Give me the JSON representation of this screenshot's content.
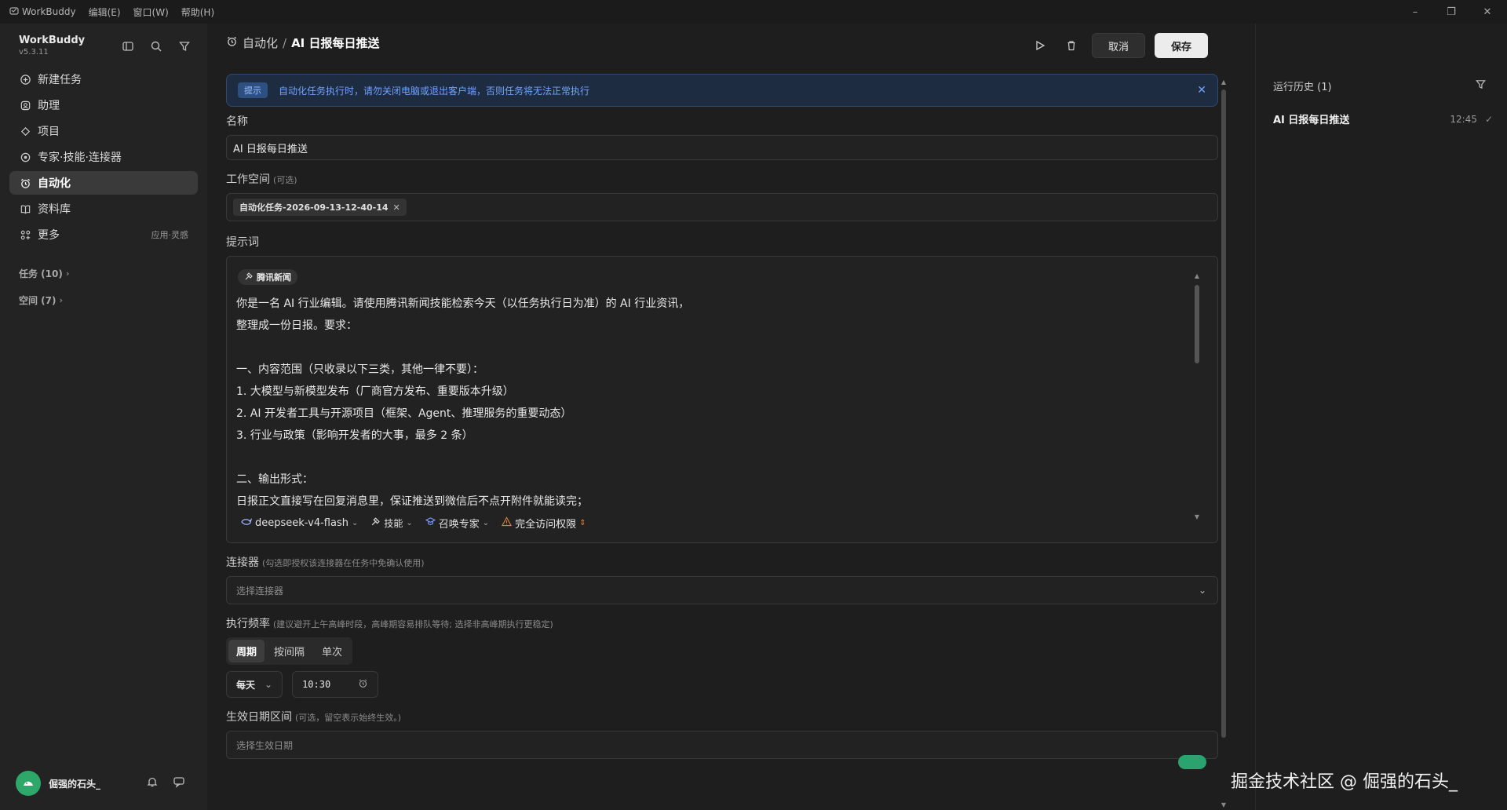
{
  "titlebar": {
    "app_name": "WorkBuddy",
    "menus": [
      "编辑(E)",
      "窗口(W)",
      "帮助(H)"
    ]
  },
  "sidebar": {
    "brand_name": "WorkBuddy",
    "version": "v5.3.11",
    "nav": [
      {
        "label": "新建任务",
        "icon": "plus-circle-icon"
      },
      {
        "label": "助理",
        "icon": "assistant-icon"
      },
      {
        "label": "项目",
        "icon": "project-icon"
      },
      {
        "label": "专家·技能·连接器",
        "icon": "expert-icon"
      },
      {
        "label": "自动化",
        "icon": "alarm-icon",
        "active": true
      },
      {
        "label": "资料库",
        "icon": "book-icon"
      },
      {
        "label": "更多",
        "icon": "grid-icon",
        "extra": "应用·灵感"
      }
    ],
    "groups": [
      {
        "label": "任务 (10)"
      },
      {
        "label": "空间 (7)"
      }
    ],
    "user_name": "倔强的石头_"
  },
  "header": {
    "crumb_parent": "自动化",
    "crumb_sep": "/",
    "crumb_current": "AI 日报每日推送",
    "cancel_label": "取消",
    "save_label": "保存"
  },
  "notice": {
    "tag": "提示",
    "text": "自动化任务执行时，请勿关闭电脑或退出客户端，否则任务将无法正常执行"
  },
  "form": {
    "name_label": "名称",
    "name_value": "AI 日报每日推送",
    "workspace_label": "工作空间",
    "workspace_optional": "(可选)",
    "workspace_chip": "自动化任务-2026-09-13-12-40-14",
    "prompt_label": "提示词",
    "skill_chip": "腾讯新闻",
    "prompt_lines": [
      "你是一名 AI 行业编辑。请使用腾讯新闻技能检索今天（以任务执行日为准）的 AI 行业资讯，",
      "整理成一份日报。要求：",
      "",
      "一、内容范围（只收录以下三类，其他一律不要）：",
      "1. 大模型与新模型发布（厂商官方发布、重要版本升级）",
      "2. AI 开发者工具与开源项目（框架、Agent、推理服务的重要动态）",
      "3. 行业与政策（影响开发者的大事，最多 2 条）",
      "",
      "二、输出形式：",
      "日报正文直接写在回复消息里，保证推送到微信后不点开附件就能读完；"
    ],
    "model": "deepseek-v4-flash",
    "skills_btn": "技能",
    "expert_btn": "召唤专家",
    "perm_btn": "完全访问权限",
    "connector_label": "连接器",
    "connector_hint": "(勾选即授权该连接器在任务中免确认使用)",
    "connector_placeholder": "选择连接器",
    "freq_label": "执行频率",
    "freq_hint": "(建议避开上午高峰时段，高峰期容易排队等待; 选择非高峰期执行更稳定)",
    "freq_tabs": [
      "周期",
      "按间隔",
      "单次"
    ],
    "freq_period": "每天",
    "freq_time": "10:30",
    "date_label": "生效日期区间",
    "date_hint": "(可选，留空表示始终生效。)",
    "date_placeholder": "选择生效日期"
  },
  "history": {
    "title": "运行历史 (1)",
    "items": [
      {
        "title": "AI 日报每日推送",
        "time": "12:45"
      }
    ]
  },
  "watermark": "掘金技术社区 @ 倔强的石头_",
  "colors": {
    "accent_blue": "#6fa2ff",
    "toggle_green": "#2ba36e",
    "perm_warning": "#e0803a",
    "expert_blue": "#7a9cff"
  }
}
